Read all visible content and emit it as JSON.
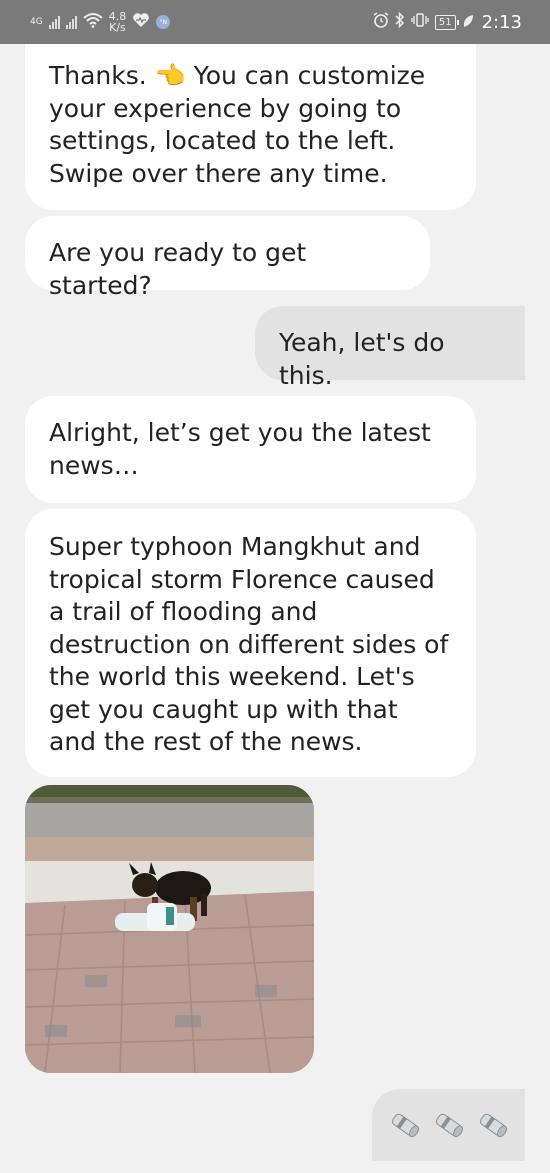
{
  "status_bar": {
    "network_type": "4G",
    "net_speed_value": "4.8",
    "net_speed_unit": "K/s",
    "nfc_badge": "°N",
    "battery_level": "51",
    "time": "2:13"
  },
  "messages": [
    {
      "sender": "bot",
      "text": "Thanks. 👈 You can customize your experience by going to settings, located to the left. Swipe over there any time."
    },
    {
      "sender": "bot",
      "text": "Are you ready to get started?"
    },
    {
      "sender": "user",
      "text": "Yeah, let's do this."
    },
    {
      "sender": "bot",
      "text": "Alright, let’s get you the latest news…"
    },
    {
      "sender": "bot",
      "text": "Super typhoon Mangkhut and tropical storm Florence caused a trail of flooding and destruction on different sides of the world this weekend. Let's get you caught up with that and the rest of the news."
    },
    {
      "sender": "bot",
      "type": "image",
      "icon": "puppy-carrying-newspaper-gif"
    },
    {
      "sender": "user",
      "type": "emoji",
      "icons": [
        "rolled-newspaper-icon",
        "rolled-newspaper-icon",
        "rolled-newspaper-icon"
      ]
    }
  ],
  "colors": {
    "status_bar_bg": "#7a7a7a",
    "screen_bg": "#f1f1f1",
    "bot_bubble": "#ffffff",
    "user_bubble": "#e2e2e2"
  }
}
